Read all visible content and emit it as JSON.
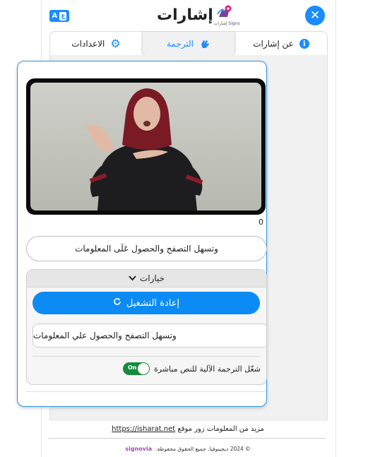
{
  "stray_glyph": "ﻉ",
  "header": {
    "title": "إشارات",
    "logo_subtitle": "إشارات Signs",
    "lang_a": "A",
    "lang_z": "ع"
  },
  "tabs": [
    {
      "label": "عن إشارات",
      "icon": "info-icon"
    },
    {
      "label": "الترجمة",
      "icon": "sign-hand-icon"
    },
    {
      "label": "الاعدادات",
      "icon": "gear-icon"
    }
  ],
  "video": {
    "counter": "0"
  },
  "translated_text": "وتسهل التصفح والحصول عَلَى المعلومات",
  "options": {
    "header_label": "خيارات",
    "replay_label": "إعادة التشغيل",
    "sentence": "وتسهل التصفح والحصول علي المعلومات",
    "toggle_label": "شغّل الترجمة الآلية للنص مباشرة",
    "toggle_state": "On"
  },
  "footer": {
    "more_info": "مزيد من المعلومات زور موقع",
    "link": "https://isharat.net",
    "copyright": "© 2024 ديجينوفيا. جميع الحقوق محفوظة.",
    "brand": "signovia"
  },
  "colors": {
    "accent": "#1a8cff",
    "toggle_on": "#168a3e",
    "card_border": "#2d95e8"
  }
}
